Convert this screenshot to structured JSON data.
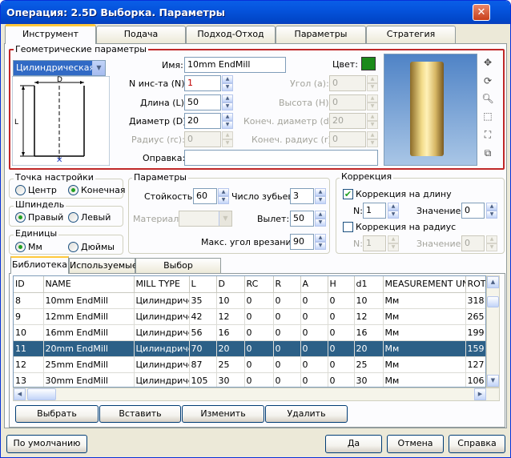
{
  "window": {
    "title": "Операция: 2.5D Выборка. Параметры",
    "close": "✕"
  },
  "tabs": [
    "Инструмент",
    "Подача",
    "Подход-Отход",
    "Параметры",
    "Стратегия"
  ],
  "geometry": {
    "label": "Геометрические параметры",
    "tool_type": "Цилиндрическая ф",
    "name_label": "Имя:",
    "name_value": "10mm EndMill",
    "color_label": "Цвет:",
    "color_value": "#1a8a1a",
    "n_label": "N инс-та (N):",
    "n_value": "1",
    "angle_label": "Угол (a):",
    "angle_value": "0",
    "length_label": "Длина (L):",
    "length_value": "50",
    "height_label": "Высота (H):",
    "height_value": "0",
    "diameter_label": "Диаметр (D):",
    "diameter_value": "20",
    "end_diam_label": "Конеч. диаметр (d):",
    "end_diam_value": "20",
    "radius_label": "Радиус (rc):",
    "radius_value": "0",
    "end_radius_label": "Конеч. радиус (r):",
    "end_radius_value": "0",
    "holder_label": "Оправка:",
    "holder_value": "",
    "dim_d": "D",
    "dim_l": "L"
  },
  "setpoint": {
    "label": "Точка настройки",
    "opt1": "Центр",
    "opt2": "Конечная"
  },
  "spindle": {
    "label": "Шпиндель",
    "opt1": "Правый",
    "opt2": "Левый"
  },
  "units": {
    "label": "Единицы",
    "opt1": "Мм",
    "opt2": "Дюймы"
  },
  "params": {
    "label": "Параметры",
    "life_label": "Стойкость:",
    "life_value": "60",
    "teeth_label": "Число зубьев:",
    "teeth_value": "3",
    "material_label": "Материал:",
    "material_value": "",
    "overhang_label": "Вылет:",
    "overhang_value": "50",
    "plunge_label": "Макс. угол врезания:",
    "plunge_value": "90"
  },
  "correction": {
    "label": "Коррекция",
    "length_label": "Коррекция на длину",
    "n_label": "N:",
    "n_value": "1",
    "val_label": "Значение:",
    "val_value": "0",
    "radius_label": "Коррекция на радиус",
    "n2_value": "1",
    "val2_value": "0"
  },
  "subtabs": [
    "Библиотека",
    "Используемые",
    "Выбор библиотеки"
  ],
  "table": {
    "columns": [
      "ID",
      "NAME",
      "MILL TYPE",
      "L",
      "D",
      "RC",
      "R",
      "A",
      "H",
      "d1",
      "MEASUREMENT UNIT",
      "ROTA"
    ],
    "rows": [
      [
        "8",
        "10mm EndMill",
        "Цилиндричес",
        "35",
        "10",
        "0",
        "0",
        "0",
        "0",
        "10",
        "Мм",
        "318"
      ],
      [
        "9",
        "12mm EndMill",
        "Цилиндричес",
        "42",
        "12",
        "0",
        "0",
        "0",
        "0",
        "12",
        "Мм",
        "265"
      ],
      [
        "10",
        "16mm EndMill",
        "Цилиндричес",
        "56",
        "16",
        "0",
        "0",
        "0",
        "0",
        "16",
        "Мм",
        "199"
      ],
      [
        "11",
        "20mm EndMill",
        "Цилиндричес",
        "70",
        "20",
        "0",
        "0",
        "0",
        "0",
        "20",
        "Мм",
        "159"
      ],
      [
        "12",
        "25mm EndMill",
        "Цилиндричес",
        "87",
        "25",
        "0",
        "0",
        "0",
        "0",
        "25",
        "Мм",
        "127"
      ],
      [
        "13",
        "30mm EndMill",
        "Цилиндричес",
        "105",
        "30",
        "0",
        "0",
        "0",
        "0",
        "30",
        "Мм",
        "106"
      ]
    ],
    "selected_index": 3
  },
  "lib_buttons": [
    "Выбрать",
    "Вставить",
    "Изменить",
    "Удалить"
  ],
  "bottom": {
    "default": "По умолчанию",
    "ok": "Да",
    "cancel": "Отмена",
    "help": "Справка"
  }
}
